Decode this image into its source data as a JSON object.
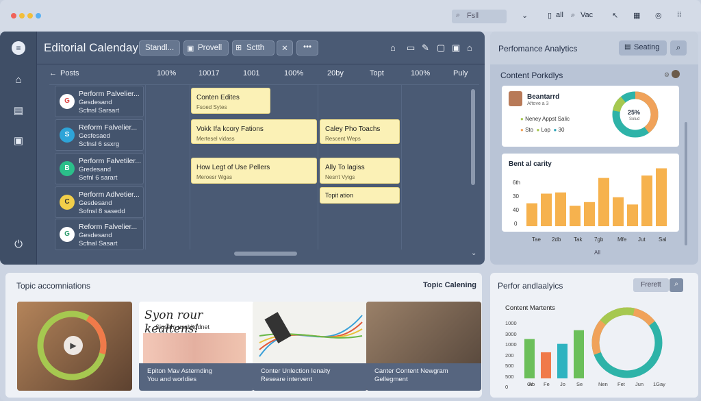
{
  "topbar": {
    "search_placeholder": "Fsll",
    "item_all": "all",
    "item_vac": "Vac",
    "colors": {
      "red": "#f0625a",
      "yellow": "#f2be3a",
      "blue": "#5ab1f2"
    }
  },
  "calendar": {
    "title": "Editorial Calenday",
    "tabs": [
      "Standl...",
      "Provell",
      "Sctth"
    ],
    "columns": [
      "Posts",
      "100%",
      "10017",
      "1001",
      "100%",
      "20by",
      "Topt",
      "100%",
      "Puly"
    ],
    "posts": [
      {
        "l1": "Perform Palvelier...",
        "l2": "Gesdesand",
        "l3": "Scfnsl Sarsart",
        "icon": "G"
      },
      {
        "l1": "Reform Falvelier...",
        "l2": "Gesfesaed",
        "l3": "Scfnsl 6 ssxrg",
        "icon": "S"
      },
      {
        "l1": "Perform Falvetiler...",
        "l2": "Gredesand",
        "l3": "Sefnl 6 sarart",
        "icon": "B"
      },
      {
        "l1": "Perform Adlvetier...",
        "l2": "Gesdesand",
        "l3": "Sofnsl 8 sasedd",
        "icon": "C"
      },
      {
        "l1": "Reform Falvelier...",
        "l2": "Gesdesand",
        "l3": "Scfnal Sasart",
        "icon": "G"
      }
    ],
    "cards": [
      {
        "title": "Conten Edites",
        "sub": "Fsoed Sytes"
      },
      {
        "title": "Vokk Ifa kcory Fations",
        "sub": "Mertesel vidass"
      },
      {
        "title": "Caley Pho Toachs",
        "sub": "Rescent Weps"
      },
      {
        "title": "How Legt of Use Pellers",
        "sub": "Meroesr Wgas"
      },
      {
        "title": "Ally To lagiss",
        "sub": "Nesrrt Vyigs"
      },
      {
        "title": "Topit ation",
        "sub": ""
      }
    ]
  },
  "analytics": {
    "title": "Perfomance Analytics",
    "button": "Seating",
    "portfolio_title": "Content Porkdlys",
    "profile_name": "Beantarrd",
    "profile_sub": "Aftove a 3",
    "profile_note": "Neney Appst Salic",
    "donut_value": "25%",
    "donut_sub": "Solud",
    "legend": [
      "Sto",
      "Lop",
      "30"
    ],
    "bar_title": "Bent al carity",
    "y_ticks": [
      "6th",
      "30",
      "40",
      "0"
    ],
    "x_ticks": [
      "Tae",
      "2db",
      "Tak",
      "7gb",
      "Mfe",
      "Jut",
      "Sal"
    ],
    "footer": "All"
  },
  "topics": {
    "title": "Topic accomniations",
    "right_title": "Topic Calening",
    "tiles": [
      {
        "cap1": "",
        "cap2": ""
      },
      {
        "headline": "Syon rour kealtens!",
        "subline": "Sigsam usabltgdnet",
        "cap1": "Epiton Mav Asternding",
        "cap2": "You and worldies"
      },
      {
        "cap1": "Conter Unlection Ienaity",
        "cap2": "Researe intervent"
      },
      {
        "cap1": "Canter Content Newgram",
        "cap2": "Gellegment"
      }
    ]
  },
  "bottom_analytics": {
    "title": "Perfor andlaalyics",
    "button": "Frerett",
    "chart_title": "Content Martents",
    "y_ticks": [
      "1000",
      "3000",
      "1000",
      "200",
      "500",
      "500",
      "0"
    ],
    "x_ticks": [
      "Or",
      "Ab",
      "Fe",
      "Jo",
      "Se",
      "Nen",
      "Fet",
      "Jun",
      "1Gay"
    ]
  },
  "chart_data": [
    {
      "type": "bar",
      "title": "Bent al carity",
      "categories": [
        "Tae",
        "2db",
        "Tak",
        "7gb",
        "Mfe",
        "Jut",
        "Sal"
      ],
      "values": [
        19,
        27,
        28,
        17,
        20,
        40,
        24,
        18,
        42,
        48
      ]
    },
    {
      "type": "bar",
      "title": "Content Martents",
      "categories": [
        "Or",
        "Ab",
        "Fe",
        "Jo",
        "Se"
      ],
      "values": [
        980,
        650,
        860,
        1200,
        720
      ]
    }
  ]
}
